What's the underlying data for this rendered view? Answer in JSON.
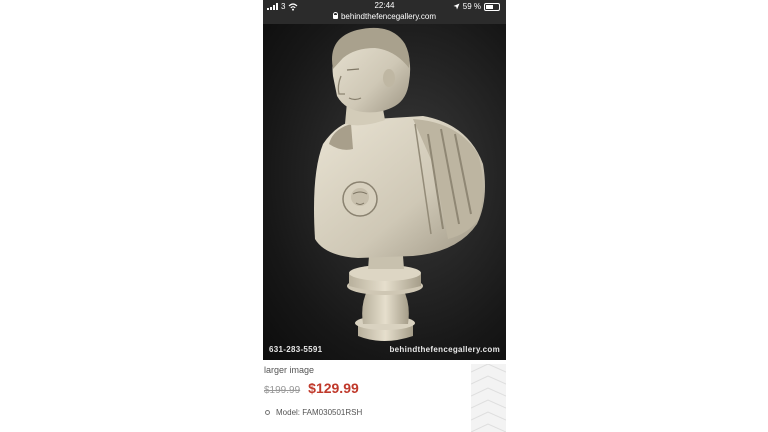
{
  "status_bar": {
    "carrier": "3",
    "time": "22:44",
    "battery": "59 %",
    "url": "behindthefencegallery.com"
  },
  "product": {
    "image_watermark_phone": "631-283-5591",
    "image_watermark_site": "behindthefencegallery.com",
    "larger_image_label": "larger image",
    "old_price": "$199.99",
    "new_price": "$129.99",
    "model": "Model: FAM030501RSH"
  },
  "colors": {
    "status_bar_bg": "#2b2b2b",
    "sale_price": "#c0392b",
    "photo_bg": "#171717"
  }
}
